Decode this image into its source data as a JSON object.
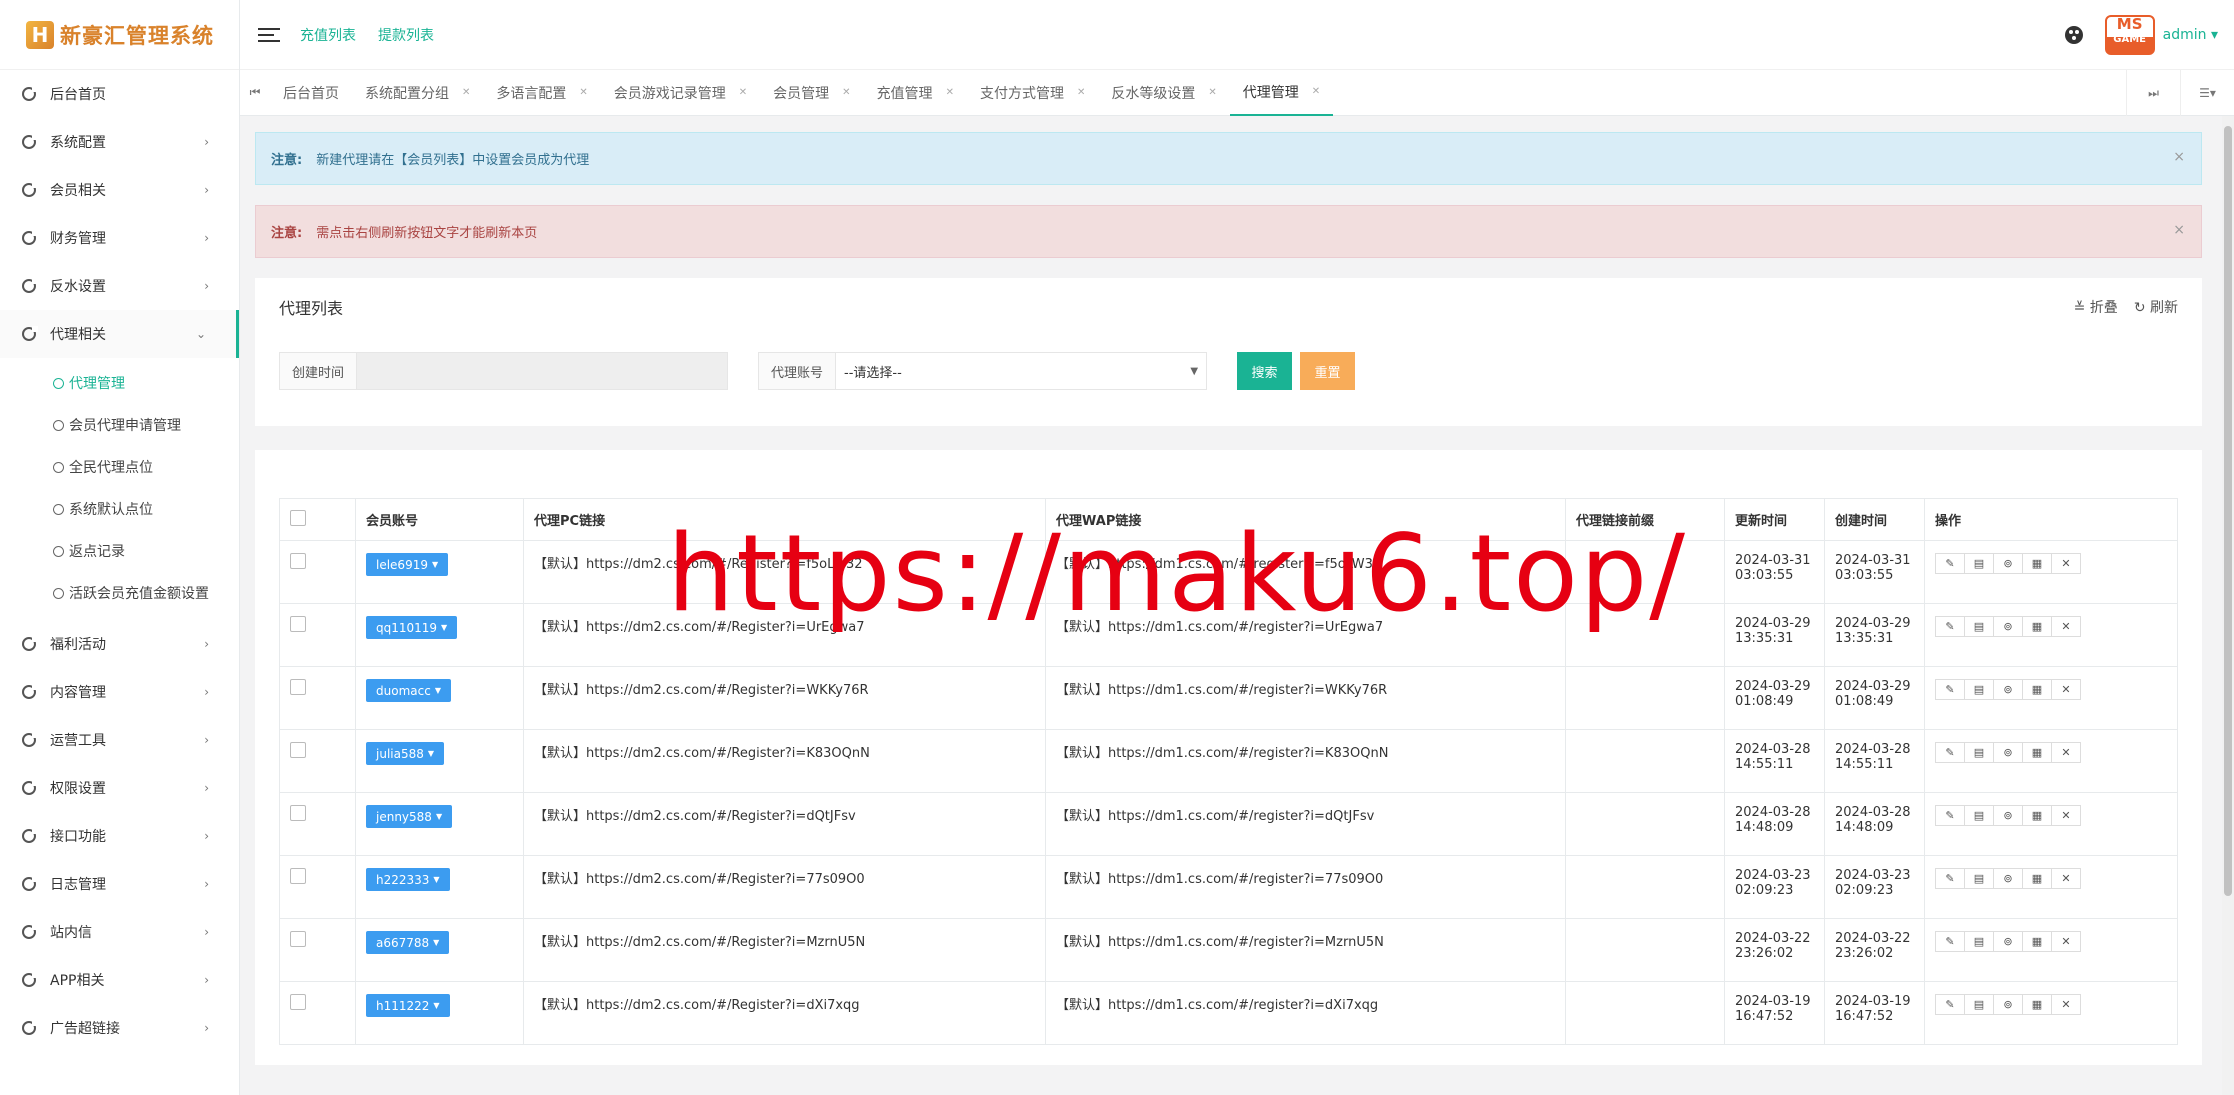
{
  "brand": {
    "logo_letter": "H",
    "name": "新豪汇管理系统"
  },
  "header": {
    "links": [
      "充值列表",
      "提款列表"
    ],
    "avatar_text_top": "MS",
    "avatar_text_bottom": "GAME",
    "user": "admin ▾"
  },
  "sidebar": {
    "items": [
      {
        "label": "后台首页",
        "arrow": ""
      },
      {
        "label": "系统配置",
        "arrow": "›"
      },
      {
        "label": "会员相关",
        "arrow": "›"
      },
      {
        "label": "财务管理",
        "arrow": "›"
      },
      {
        "label": "反水设置",
        "arrow": "›"
      },
      {
        "label": "代理相关",
        "arrow": "⌄"
      }
    ],
    "sub_items": [
      "代理管理",
      "会员代理申请管理",
      "全民代理点位",
      "系统默认点位",
      "返点记录",
      "活跃会员充值金额设置"
    ],
    "items_after": [
      {
        "label": "福利活动",
        "arrow": "›"
      },
      {
        "label": "内容管理",
        "arrow": "›"
      },
      {
        "label": "运营工具",
        "arrow": "›"
      },
      {
        "label": "权限设置",
        "arrow": "›"
      },
      {
        "label": "接口功能",
        "arrow": "›"
      },
      {
        "label": "日志管理",
        "arrow": "›"
      },
      {
        "label": "站内信",
        "arrow": "›"
      },
      {
        "label": "APP相关",
        "arrow": "›"
      },
      {
        "label": "广告超链接",
        "arrow": "›"
      }
    ]
  },
  "tabs": {
    "items": [
      "后台首页",
      "系统配置分组",
      "多语言配置",
      "会员游戏记录管理",
      "会员管理",
      "充值管理",
      "支付方式管理",
      "反水等级设置",
      "代理管理"
    ],
    "nav_left": "⏮",
    "nav_right": "⏭",
    "menu": "☰▾"
  },
  "alerts": {
    "info": {
      "prefix": "注意:",
      "text": "新建代理请在【会员列表】中设置会员成为代理"
    },
    "danger": {
      "prefix": "注意:",
      "text": "需点击右侧刷新按钮文字才能刷新本页"
    },
    "close": "×"
  },
  "panel": {
    "title": "代理列表",
    "collapse": "≚ 折叠",
    "refresh": "↻ 刷新"
  },
  "filter": {
    "created_label": "创建时间",
    "created_value": "",
    "account_label": "代理账号",
    "account_value": "--请选择--",
    "search_label": "搜索",
    "reset_label": "重置"
  },
  "table": {
    "headers": [
      "会员账号",
      "代理PC链接",
      "代理WAP链接",
      "代理链接前缀",
      "更新时间",
      "创建时间",
      "操作"
    ],
    "rows": [
      {
        "account": "lele6919",
        "pc": "【默认】https://dm2.cs.com/#/Register?i=f5oLW32",
        "wap": "【默认】https://dm1.cs.com/#/register?i=f5oLW32",
        "prefix": "",
        "updated_date": "2024-03-31",
        "updated_time": "03:03:55",
        "created_date": "2024-03-31",
        "created_time": "03:03:55"
      },
      {
        "account": "qq110119",
        "pc": "【默认】https://dm2.cs.com/#/Register?i=UrEgwa7",
        "wap": "【默认】https://dm1.cs.com/#/register?i=UrEgwa7",
        "prefix": "",
        "updated_date": "2024-03-29",
        "updated_time": "13:35:31",
        "created_date": "2024-03-29",
        "created_time": "13:35:31"
      },
      {
        "account": "duomacc",
        "pc": "【默认】https://dm2.cs.com/#/Register?i=WKKy76R",
        "wap": "【默认】https://dm1.cs.com/#/register?i=WKKy76R",
        "prefix": "",
        "updated_date": "2024-03-29",
        "updated_time": "01:08:49",
        "created_date": "2024-03-29",
        "created_time": "01:08:49"
      },
      {
        "account": "julia588",
        "pc": "【默认】https://dm2.cs.com/#/Register?i=K83OQnN",
        "wap": "【默认】https://dm1.cs.com/#/register?i=K83OQnN",
        "prefix": "",
        "updated_date": "2024-03-28",
        "updated_time": "14:55:11",
        "created_date": "2024-03-28",
        "created_time": "14:55:11"
      },
      {
        "account": "jenny588",
        "pc": "【默认】https://dm2.cs.com/#/Register?i=dQtJFsv",
        "wap": "【默认】https://dm1.cs.com/#/register?i=dQtJFsv",
        "prefix": "",
        "updated_date": "2024-03-28",
        "updated_time": "14:48:09",
        "created_date": "2024-03-28",
        "created_time": "14:48:09"
      },
      {
        "account": "h222333",
        "pc": "【默认】https://dm2.cs.com/#/Register?i=77s09O0",
        "wap": "【默认】https://dm1.cs.com/#/register?i=77s09O0",
        "prefix": "",
        "updated_date": "2024-03-23",
        "updated_time": "02:09:23",
        "created_date": "2024-03-23",
        "created_time": "02:09:23"
      },
      {
        "account": "a667788",
        "pc": "【默认】https://dm2.cs.com/#/Register?i=MzrnU5N",
        "wap": "【默认】https://dm1.cs.com/#/register?i=MzrnU5N",
        "prefix": "",
        "updated_date": "2024-03-22",
        "updated_time": "23:26:02",
        "created_date": "2024-03-22",
        "created_time": "23:26:02"
      },
      {
        "account": "h111222",
        "pc": "【默认】https://dm2.cs.com/#/Register?i=dXi7xqg",
        "wap": "【默认】https://dm1.cs.com/#/register?i=dXi7xqg",
        "prefix": "",
        "updated_date": "2024-03-19",
        "updated_time": "16:47:52",
        "created_date": "2024-03-19",
        "created_time": "16:47:52"
      }
    ],
    "op_icons": [
      "edit-icon",
      "list-icon",
      "link-icon",
      "file-icon",
      "close-icon"
    ],
    "op_glyphs": [
      "✎",
      "▤",
      "⊚",
      "▦",
      "✕"
    ]
  },
  "watermark": "https://maku6.top/",
  "colors": {
    "accent": "#1ab394",
    "account_button": "#3c9cf0",
    "reset": "#f8ac59",
    "watermark": "#e60012"
  }
}
